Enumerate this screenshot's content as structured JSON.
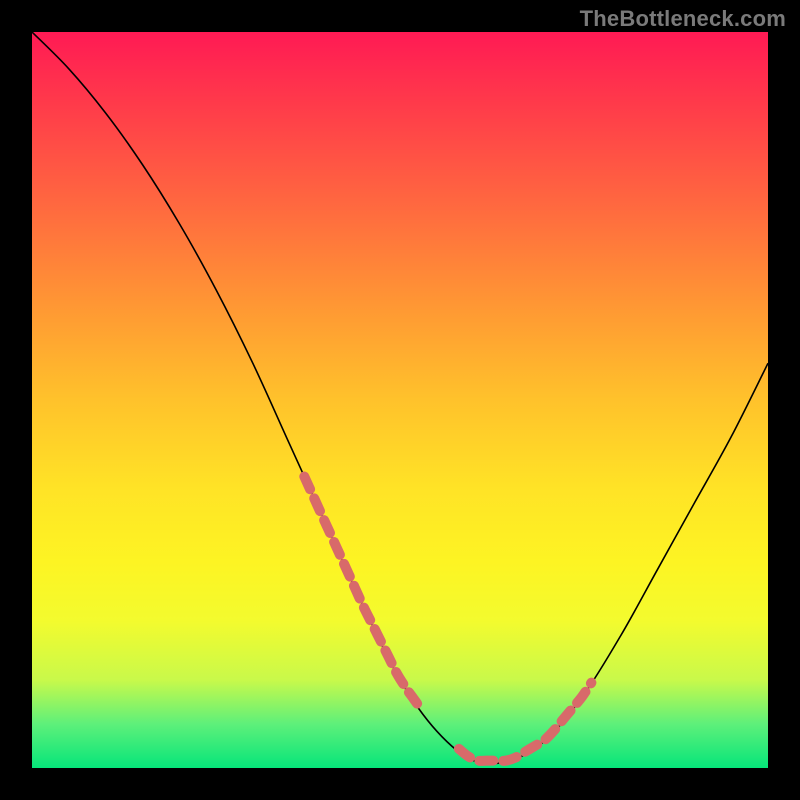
{
  "watermark": "TheBottleneck.com",
  "colors": {
    "frame_bg": "#000000",
    "gradient_top": "#ff1a54",
    "gradient_bottom": "#06e57a",
    "curve_stroke": "#000000",
    "marker_stroke": "#d86a6a",
    "watermark_text": "#7a7a7a"
  },
  "chart_data": {
    "type": "line",
    "title": "",
    "xlabel": "",
    "ylabel": "",
    "xlim": [
      0,
      100
    ],
    "ylim": [
      0,
      100
    ],
    "grid": false,
    "legend": false,
    "series": [
      {
        "name": "bottleneck-curve",
        "x": [
          0,
          5,
          10,
          15,
          20,
          25,
          30,
          35,
          40,
          45,
          50,
          55,
          60,
          65,
          70,
          75,
          80,
          85,
          90,
          95,
          100
        ],
        "values": [
          100,
          95,
          89,
          82,
          74,
          65,
          55,
          44,
          33,
          22,
          12,
          5,
          1,
          1,
          4,
          10,
          18,
          27,
          36,
          45,
          55
        ]
      }
    ],
    "annotations": [
      {
        "name": "highlight-left-dashed",
        "series": "bottleneck-curve",
        "x_range": [
          37,
          53
        ]
      },
      {
        "name": "highlight-right-dashed",
        "series": "bottleneck-curve",
        "x_range": [
          58,
          76
        ]
      }
    ],
    "notes": "V-shaped bottleneck curve over a vertical rainbow heat gradient. Minimum (~0–1%) around x≈60. Left arm is steeper; right arm rises roughly linearly. No axes, ticks, labels, or legend are rendered."
  }
}
